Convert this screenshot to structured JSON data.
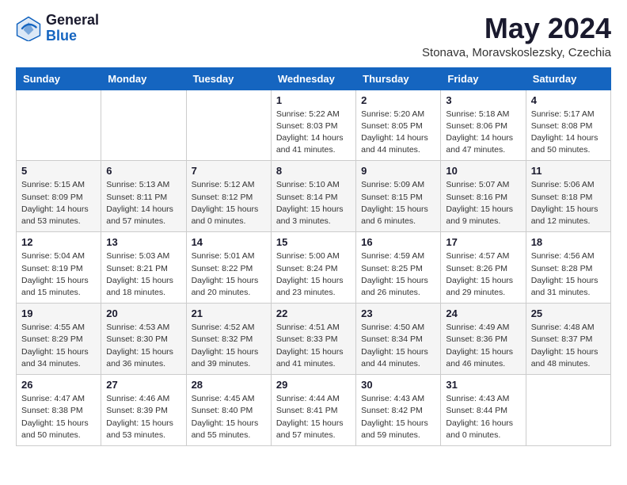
{
  "header": {
    "logo_general": "General",
    "logo_blue": "Blue",
    "month": "May 2024",
    "location": "Stonava, Moravskoslezsky, Czechia"
  },
  "weekdays": [
    "Sunday",
    "Monday",
    "Tuesday",
    "Wednesday",
    "Thursday",
    "Friday",
    "Saturday"
  ],
  "weeks": [
    [
      {
        "day": "",
        "info": ""
      },
      {
        "day": "",
        "info": ""
      },
      {
        "day": "",
        "info": ""
      },
      {
        "day": "1",
        "info": "Sunrise: 5:22 AM\nSunset: 8:03 PM\nDaylight: 14 hours\nand 41 minutes."
      },
      {
        "day": "2",
        "info": "Sunrise: 5:20 AM\nSunset: 8:05 PM\nDaylight: 14 hours\nand 44 minutes."
      },
      {
        "day": "3",
        "info": "Sunrise: 5:18 AM\nSunset: 8:06 PM\nDaylight: 14 hours\nand 47 minutes."
      },
      {
        "day": "4",
        "info": "Sunrise: 5:17 AM\nSunset: 8:08 PM\nDaylight: 14 hours\nand 50 minutes."
      }
    ],
    [
      {
        "day": "5",
        "info": "Sunrise: 5:15 AM\nSunset: 8:09 PM\nDaylight: 14 hours\nand 53 minutes."
      },
      {
        "day": "6",
        "info": "Sunrise: 5:13 AM\nSunset: 8:11 PM\nDaylight: 14 hours\nand 57 minutes."
      },
      {
        "day": "7",
        "info": "Sunrise: 5:12 AM\nSunset: 8:12 PM\nDaylight: 15 hours\nand 0 minutes."
      },
      {
        "day": "8",
        "info": "Sunrise: 5:10 AM\nSunset: 8:14 PM\nDaylight: 15 hours\nand 3 minutes."
      },
      {
        "day": "9",
        "info": "Sunrise: 5:09 AM\nSunset: 8:15 PM\nDaylight: 15 hours\nand 6 minutes."
      },
      {
        "day": "10",
        "info": "Sunrise: 5:07 AM\nSunset: 8:16 PM\nDaylight: 15 hours\nand 9 minutes."
      },
      {
        "day": "11",
        "info": "Sunrise: 5:06 AM\nSunset: 8:18 PM\nDaylight: 15 hours\nand 12 minutes."
      }
    ],
    [
      {
        "day": "12",
        "info": "Sunrise: 5:04 AM\nSunset: 8:19 PM\nDaylight: 15 hours\nand 15 minutes."
      },
      {
        "day": "13",
        "info": "Sunrise: 5:03 AM\nSunset: 8:21 PM\nDaylight: 15 hours\nand 18 minutes."
      },
      {
        "day": "14",
        "info": "Sunrise: 5:01 AM\nSunset: 8:22 PM\nDaylight: 15 hours\nand 20 minutes."
      },
      {
        "day": "15",
        "info": "Sunrise: 5:00 AM\nSunset: 8:24 PM\nDaylight: 15 hours\nand 23 minutes."
      },
      {
        "day": "16",
        "info": "Sunrise: 4:59 AM\nSunset: 8:25 PM\nDaylight: 15 hours\nand 26 minutes."
      },
      {
        "day": "17",
        "info": "Sunrise: 4:57 AM\nSunset: 8:26 PM\nDaylight: 15 hours\nand 29 minutes."
      },
      {
        "day": "18",
        "info": "Sunrise: 4:56 AM\nSunset: 8:28 PM\nDaylight: 15 hours\nand 31 minutes."
      }
    ],
    [
      {
        "day": "19",
        "info": "Sunrise: 4:55 AM\nSunset: 8:29 PM\nDaylight: 15 hours\nand 34 minutes."
      },
      {
        "day": "20",
        "info": "Sunrise: 4:53 AM\nSunset: 8:30 PM\nDaylight: 15 hours\nand 36 minutes."
      },
      {
        "day": "21",
        "info": "Sunrise: 4:52 AM\nSunset: 8:32 PM\nDaylight: 15 hours\nand 39 minutes."
      },
      {
        "day": "22",
        "info": "Sunrise: 4:51 AM\nSunset: 8:33 PM\nDaylight: 15 hours\nand 41 minutes."
      },
      {
        "day": "23",
        "info": "Sunrise: 4:50 AM\nSunset: 8:34 PM\nDaylight: 15 hours\nand 44 minutes."
      },
      {
        "day": "24",
        "info": "Sunrise: 4:49 AM\nSunset: 8:36 PM\nDaylight: 15 hours\nand 46 minutes."
      },
      {
        "day": "25",
        "info": "Sunrise: 4:48 AM\nSunset: 8:37 PM\nDaylight: 15 hours\nand 48 minutes."
      }
    ],
    [
      {
        "day": "26",
        "info": "Sunrise: 4:47 AM\nSunset: 8:38 PM\nDaylight: 15 hours\nand 50 minutes."
      },
      {
        "day": "27",
        "info": "Sunrise: 4:46 AM\nSunset: 8:39 PM\nDaylight: 15 hours\nand 53 minutes."
      },
      {
        "day": "28",
        "info": "Sunrise: 4:45 AM\nSunset: 8:40 PM\nDaylight: 15 hours\nand 55 minutes."
      },
      {
        "day": "29",
        "info": "Sunrise: 4:44 AM\nSunset: 8:41 PM\nDaylight: 15 hours\nand 57 minutes."
      },
      {
        "day": "30",
        "info": "Sunrise: 4:43 AM\nSunset: 8:42 PM\nDaylight: 15 hours\nand 59 minutes."
      },
      {
        "day": "31",
        "info": "Sunrise: 4:43 AM\nSunset: 8:44 PM\nDaylight: 16 hours\nand 0 minutes."
      },
      {
        "day": "",
        "info": ""
      }
    ]
  ]
}
